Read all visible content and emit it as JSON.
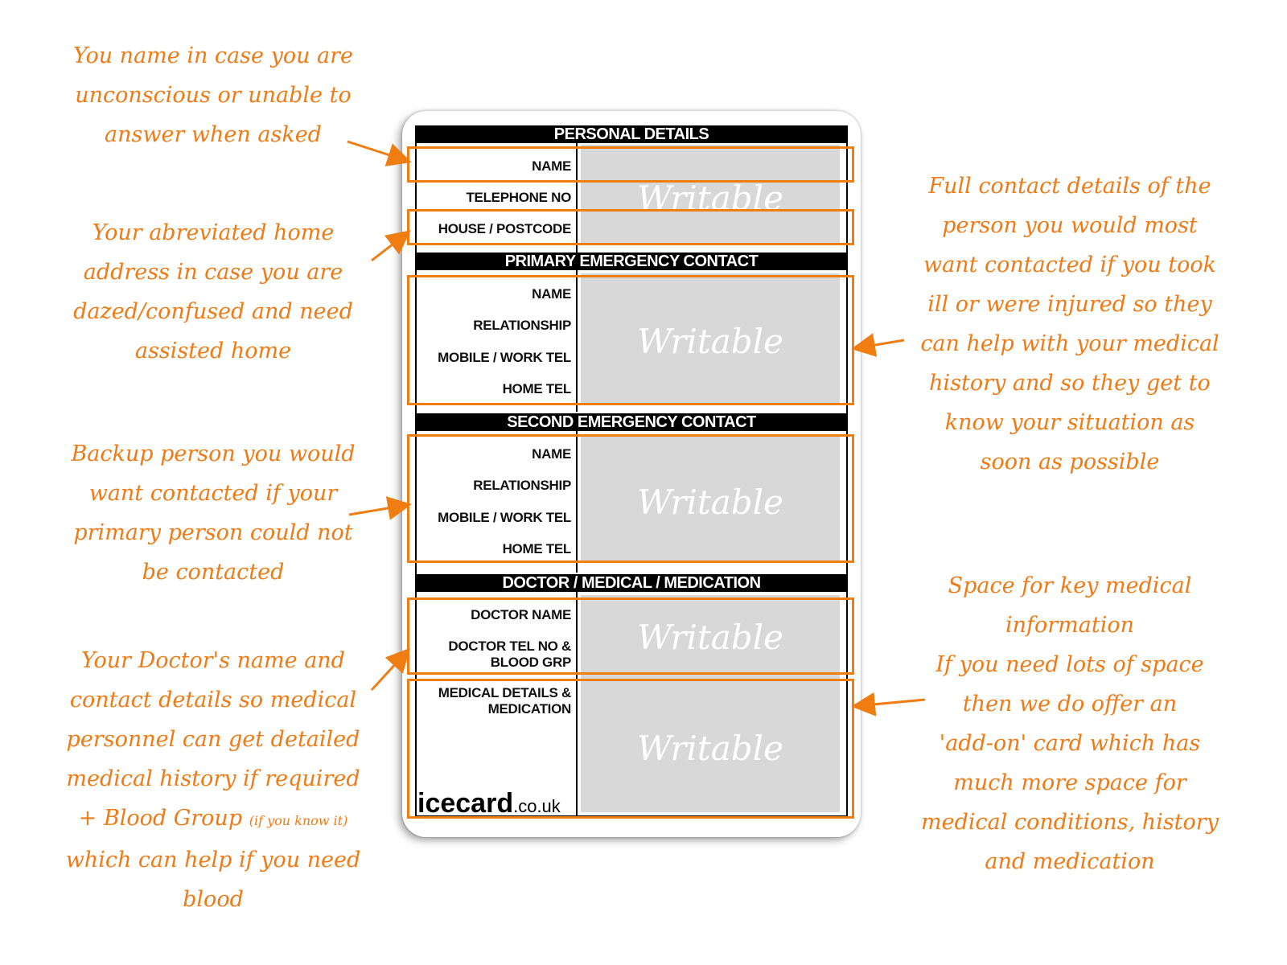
{
  "card": {
    "sections": [
      {
        "title": "PERSONAL DETAILS",
        "fields": [
          "NAME",
          "TELEPHONE NO",
          "HOUSE / POSTCODE"
        ]
      },
      {
        "title": "PRIMARY EMERGENCY CONTACT",
        "fields": [
          "NAME",
          "RELATIONSHIP",
          "MOBILE / WORK TEL",
          "HOME TEL"
        ]
      },
      {
        "title": "SECOND EMERGENCY CONTACT",
        "fields": [
          "NAME",
          "RELATIONSHIP",
          "MOBILE / WORK TEL",
          "HOME TEL"
        ]
      },
      {
        "title": "DOCTOR / MEDICAL / MEDICATION",
        "fields": [
          "DOCTOR NAME",
          "DOCTOR TEL NO & BLOOD GRP",
          "MEDICAL DETAILS & MEDICATION"
        ]
      }
    ],
    "writable_label": "Writable",
    "logo": {
      "main": "icecard",
      "suffix": ".co.uk"
    }
  },
  "annotations": {
    "name": [
      "You name in case you are",
      "unconscious or unable to",
      "answer when asked"
    ],
    "address": [
      "Your abreviated home",
      "address in case you are",
      "dazed/confused and need",
      "assisted home"
    ],
    "backup": [
      "Backup person you would",
      "want contacted if your",
      "primary person could not",
      "be contacted"
    ],
    "doctor": [
      "Your Doctor's name and",
      "contact details so medical",
      "personnel can get detailed",
      "medical history if required",
      "+ Blood Group",
      "which can help if you need",
      "blood"
    ],
    "doctor_small": "(if you know it)",
    "primary": [
      "Full contact details of the",
      "person you would most",
      "want contacted if you took",
      "ill or were injured so they",
      "can help with your medical",
      "history and so they get to",
      "know your situation as",
      "soon as possible"
    ],
    "medical": [
      "Space for key medical",
      "information",
      "If you need lots of space",
      "then we do offer an",
      "'add-on' card which has",
      "much more space for",
      "medical conditions, history",
      "and medication"
    ]
  },
  "colors": {
    "accent": "#f07d12",
    "annotation_text": "#ee7b16",
    "writable_bg": "#d8d8d8",
    "header_bg": "#000000"
  }
}
